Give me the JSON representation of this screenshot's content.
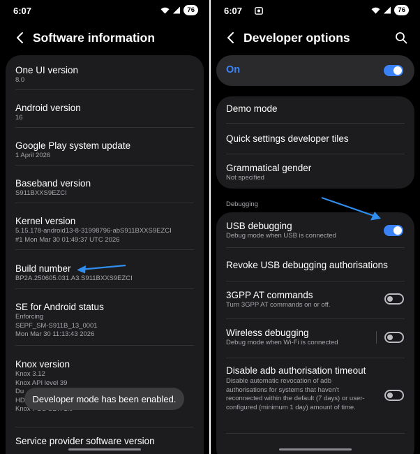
{
  "left": {
    "status": {
      "time": "6:07",
      "battery": "76"
    },
    "title": "Software information",
    "items": [
      {
        "label": "One UI version",
        "lines": [
          "8.0"
        ]
      },
      {
        "label": "Android version",
        "lines": [
          "16"
        ]
      },
      {
        "label": "Google Play system update",
        "lines": [
          "1 April 2026"
        ]
      },
      {
        "label": "Baseband version",
        "lines": [
          "S911BXXS9EZCI"
        ]
      },
      {
        "label": "Kernel version",
        "lines": [
          "5.15.178-android13-8-31998796-abS911BXXS9EZCI",
          "#1 Mon Mar 30 01:49:37 UTC 2026"
        ]
      },
      {
        "label": "Build number",
        "lines": [
          "BP2A.250605.031.A3.S911BXXS9EZCI"
        ]
      },
      {
        "label": "SE for Android status",
        "lines": [
          "Enforcing",
          "SEPF_SM-S911B_13_0001",
          "Mon Mar 30 11:13:43 2026"
        ]
      },
      {
        "label": "Knox version",
        "lines": [
          "Knox 3.12",
          "Knox API level 39",
          "Du",
          "HD",
          "Knox POS SDK 1.0"
        ]
      },
      {
        "label": "Service provider software version",
        "lines": []
      }
    ],
    "toast": "Developer mode has been enabled."
  },
  "right": {
    "status": {
      "time": "6:07",
      "battery": "76"
    },
    "title": "Developer options",
    "master": {
      "label": "On",
      "enabled": true
    },
    "group1": [
      {
        "label": "Demo mode"
      },
      {
        "label": "Quick settings developer tiles"
      },
      {
        "label": "Grammatical gender",
        "sub": "Not specified"
      }
    ],
    "section_debugging": "Debugging",
    "group2": [
      {
        "label": "USB debugging",
        "sub": "Debug mode when USB is connected",
        "toggle": true
      },
      {
        "label": "Revoke USB debugging authorisations"
      },
      {
        "label": "3GPP AT commands",
        "sub": "Turn 3GPP AT commands on or off.",
        "toggle": false
      },
      {
        "label": "Wireless debugging",
        "sub": "Debug mode when Wi-Fi is connected",
        "toggle": false
      },
      {
        "label": "Disable adb authorisation timeout",
        "sub": "Disable automatic revocation of adb authorisations for systems that haven't reconnected within the default (7 days) or user-configured (minimum 1 day) amount of time.",
        "toggle": false
      }
    ]
  },
  "colors": {
    "background": "#000000",
    "card": "#1c1c1e",
    "accent": "#3b82f6",
    "annotation_arrow": "#2f8ef0",
    "toast": "#3c3c3e"
  },
  "icons": [
    "back-arrow-icon",
    "search-icon",
    "wifi-icon",
    "signal-icon",
    "screen-record-icon",
    "annotation-arrow-icon"
  ]
}
